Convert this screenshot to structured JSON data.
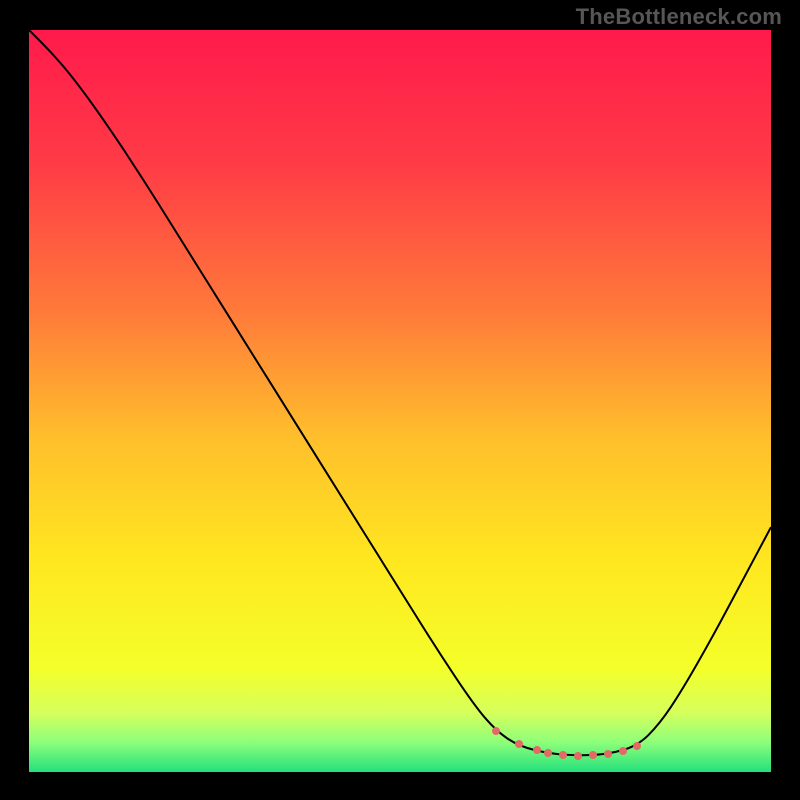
{
  "watermark": "TheBottleneck.com",
  "colors": {
    "dot": "#e26a64",
    "curve": "#000000",
    "gradient_stops": [
      {
        "pct": 0,
        "color": "#ff1a4b"
      },
      {
        "pct": 18,
        "color": "#ff3b46"
      },
      {
        "pct": 38,
        "color": "#ff7a3a"
      },
      {
        "pct": 55,
        "color": "#ffbf2c"
      },
      {
        "pct": 72,
        "color": "#ffe81f"
      },
      {
        "pct": 86,
        "color": "#f4ff2a"
      },
      {
        "pct": 92,
        "color": "#d6ff5c"
      },
      {
        "pct": 96,
        "color": "#8dff7a"
      },
      {
        "pct": 100,
        "color": "#23e07c"
      }
    ]
  },
  "chart_data": {
    "type": "line",
    "title": "",
    "xlabel": "",
    "ylabel": "",
    "xlim": [
      0,
      100
    ],
    "ylim": [
      0,
      100
    ],
    "grid": false,
    "legend": false,
    "series": [
      {
        "name": "bottleneck-curve",
        "x": [
          0,
          3,
          6,
          10,
          15,
          20,
          25,
          30,
          35,
          40,
          45,
          50,
          55,
          60,
          63,
          66,
          70,
          74,
          78,
          82,
          85,
          88,
          92,
          96,
          100
        ],
        "y": [
          100,
          97,
          93.5,
          88,
          80.5,
          72.5,
          64.5,
          56.5,
          48.5,
          40.5,
          32.5,
          24.5,
          16.5,
          9,
          5.5,
          3.5,
          2.5,
          2.2,
          2.4,
          3.5,
          6.5,
          11,
          18,
          25.5,
          33
        ]
      }
    ],
    "markers": {
      "name": "flat-region-dots",
      "x": [
        63,
        66,
        68.5,
        70,
        72,
        74,
        76,
        78,
        80,
        82
      ],
      "y": [
        5.5,
        3.8,
        3.0,
        2.6,
        2.3,
        2.2,
        2.25,
        2.4,
        2.8,
        3.5
      ]
    }
  }
}
